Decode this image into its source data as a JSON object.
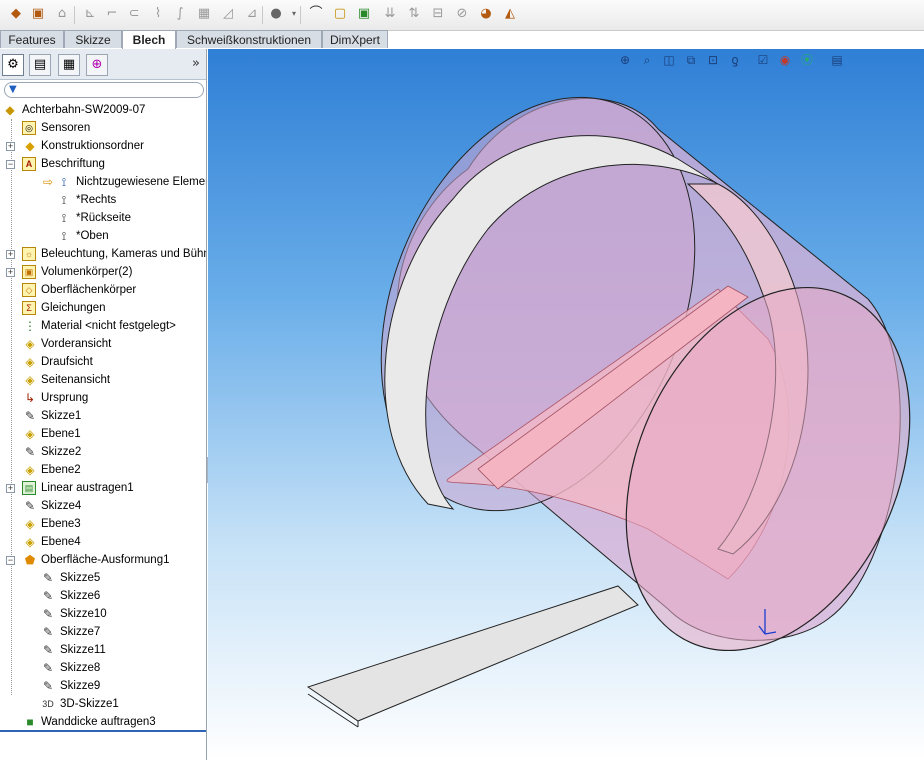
{
  "toolbar": {
    "icons": [
      "sheet-metal-icon",
      "base-flange-icon",
      "convert-icon",
      "edge-flange-icon",
      "miter-flange-icon",
      "hem-icon",
      "jog-icon",
      "sketched-bend-icon",
      "cross-break-icon",
      "closed-corner-icon",
      "welded-corner-icon",
      "break-corner-icon",
      "forming-tool-icon",
      "unfold-icon",
      "fold-icon",
      "flatten-icon",
      "no-bends-icon",
      "insert-bends-icon",
      "rip-icon",
      "extruded-cut-icon",
      "simple-hole-icon",
      "vent-icon"
    ]
  },
  "tabs": [
    {
      "label": "Features"
    },
    {
      "label": "Skizze"
    },
    {
      "label": "Blech"
    },
    {
      "label": "Schweißkonstruktionen"
    },
    {
      "label": "DimXpert"
    }
  ],
  "panel": {
    "chevron": "»",
    "tree": [
      {
        "label": "Achterbahn-SW2009-07"
      },
      {
        "label": "Sensoren"
      },
      {
        "label": "Konstruktionsordner"
      },
      {
        "label": "Beschriftung"
      },
      {
        "label": "Nichtzugewiesene Elemente"
      },
      {
        "label": "*Rechts"
      },
      {
        "label": "*Rückseite"
      },
      {
        "label": "*Oben"
      },
      {
        "label": "Beleuchtung, Kameras und Bühne"
      },
      {
        "label": "Volumenkörper(2)"
      },
      {
        "label": "Oberflächenkörper"
      },
      {
        "label": "Gleichungen"
      },
      {
        "label": "Material <nicht festgelegt>"
      },
      {
        "label": "Vorderansicht"
      },
      {
        "label": "Draufsicht"
      },
      {
        "label": "Seitenansicht"
      },
      {
        "label": "Ursprung"
      },
      {
        "label": "Skizze1"
      },
      {
        "label": "Ebene1"
      },
      {
        "label": "Skizze2"
      },
      {
        "label": "Ebene2"
      },
      {
        "label": "Linear austragen1"
      },
      {
        "label": "Skizze4"
      },
      {
        "label": "Ebene3"
      },
      {
        "label": "Ebene4"
      },
      {
        "label": "Oberfläche-Ausformung1"
      },
      {
        "label": "Skizze5"
      },
      {
        "label": "Skizze6"
      },
      {
        "label": "Skizze10"
      },
      {
        "label": "Skizze7"
      },
      {
        "label": "Skizze11"
      },
      {
        "label": "Skizze8"
      },
      {
        "label": "Skizze9"
      },
      {
        "label": "3D-Skizze1"
      },
      {
        "label": "Wanddicke auftragen3"
      }
    ]
  },
  "view_tools": [
    "zoom-to-fit-icon",
    "zoom-area-icon",
    "previous-view-icon",
    "section-view-icon",
    "view-orientation-icon",
    "display-style-icon",
    "hide-show-items-icon",
    "edit-appearance-icon",
    "apply-scene-icon",
    "view-settings-icon"
  ],
  "colors": {
    "cylinder_fill": "#d8b0d6",
    "band_fill": "#e6e6e6",
    "inner_pink": "#f2b8c6",
    "viewport_top": "#2f7fd6"
  }
}
